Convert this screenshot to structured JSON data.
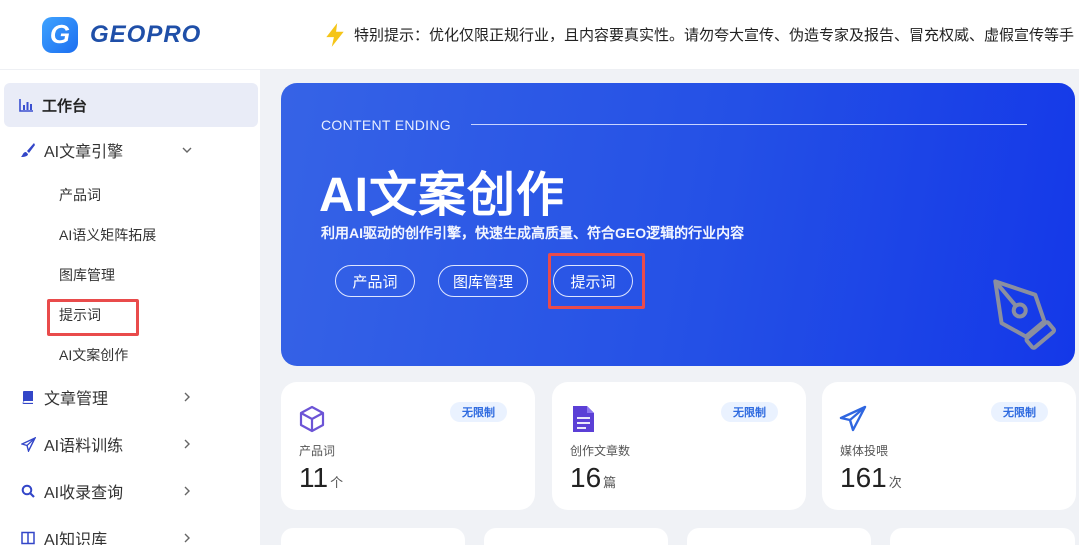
{
  "brand": {
    "logo_letter": "G",
    "name": "GEOPRO",
    "accent": "#1f4fa8"
  },
  "notice": {
    "icon": "lightning-icon",
    "text": "特别提示：优化仅限正规行业，且内容要真实性。请勿夸大宣传、伪造专家及报告、冒充权威、虚假宣传等手"
  },
  "sidebar": {
    "dashboard": {
      "label": "工作台",
      "icon": "bar-chart-icon"
    },
    "ai_article": {
      "label": "AI文章引擎",
      "icon": "brush-icon",
      "expanded": true,
      "children": [
        "产品词",
        "AI语义矩阵拓展",
        "图库管理",
        "提示词",
        "AI文案创作"
      ]
    },
    "article_mgmt": {
      "label": "文章管理",
      "icon": "book-icon"
    },
    "ai_training": {
      "label": "AI语料训练",
      "icon": "send-icon"
    },
    "ai_index": {
      "label": "AI收录查询",
      "icon": "search-icon"
    },
    "ai_kb": {
      "label": "AI知识库",
      "icon": "grid-icon"
    }
  },
  "banner": {
    "eyebrow": "CONTENT ENDING",
    "title": "AI文案创作",
    "subtitle": "利用AI驱动的创作引擎，快速生成高质量、符合GEO逻辑的行业内容",
    "buttons": [
      "产品词",
      "图库管理",
      "提示词"
    ]
  },
  "stats": [
    {
      "icon": "cube-icon",
      "badge": "无限制",
      "label": "产品词",
      "value": "11",
      "unit": "个"
    },
    {
      "icon": "document-icon",
      "badge": "无限制",
      "label": "创作文章数",
      "value": "16",
      "unit": "篇"
    },
    {
      "icon": "paper-plane-icon",
      "badge": "无限制",
      "label": "媒体投喂",
      "value": "161",
      "unit": "次"
    }
  ],
  "colors": {
    "banner": "#2450e6",
    "highlight": "#e94b4b",
    "badge_text": "#2f6be0"
  }
}
